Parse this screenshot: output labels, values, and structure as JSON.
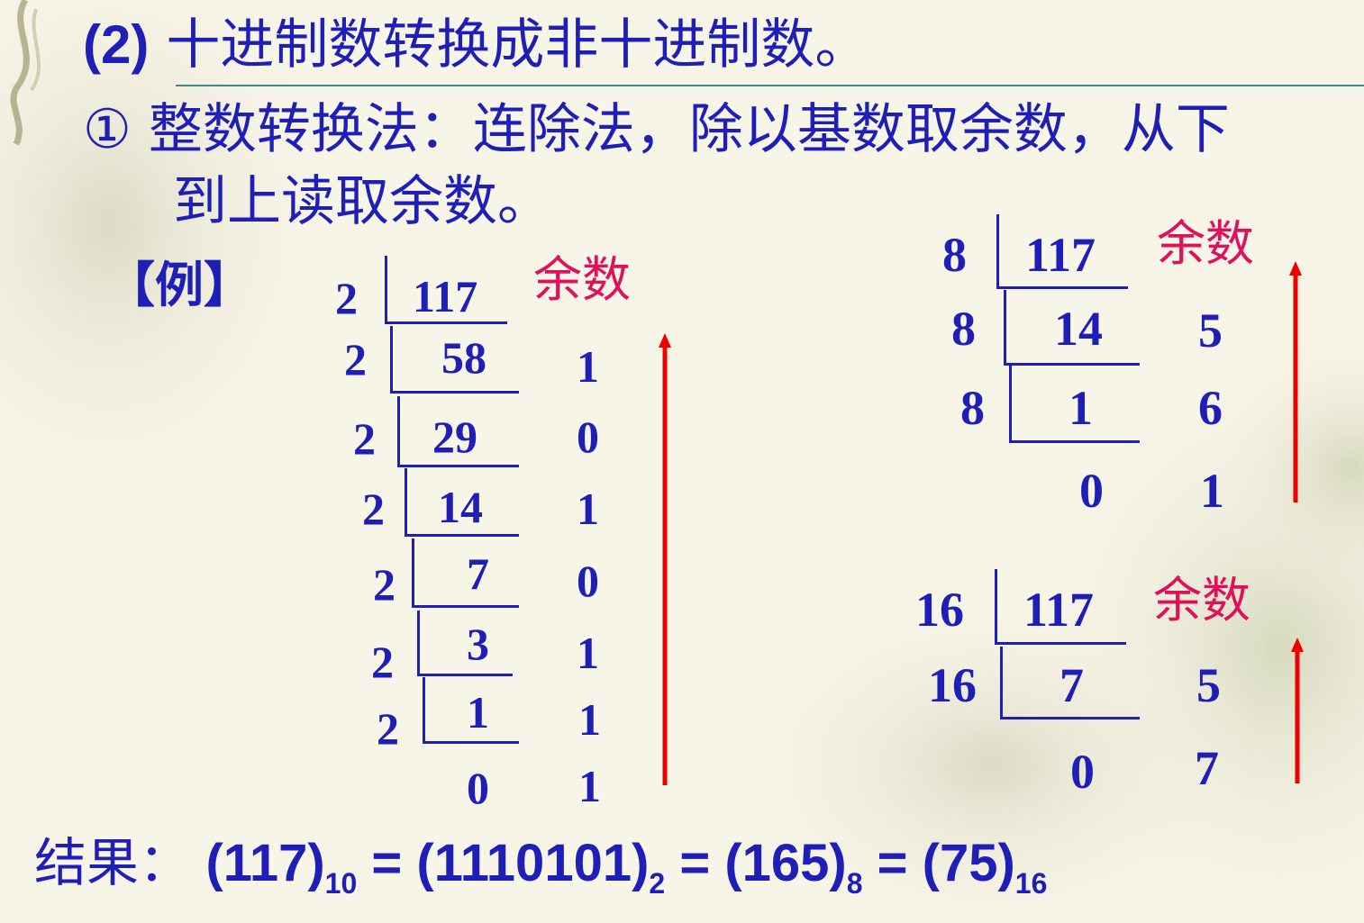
{
  "heading": {
    "number": "(2)",
    "text": "十进制数转换成非十进制数。"
  },
  "rule": {
    "line1": "① 整数转换法：连除法，除以基数取余数，从下",
    "line2": "到上读取余数。"
  },
  "example_label": "【例】",
  "remainder_label": "余数",
  "base2": {
    "divisor": "2",
    "rows": [
      {
        "divisor": "2",
        "dividend": "117",
        "remainder": ""
      },
      {
        "divisor": "2",
        "dividend": "58",
        "remainder": "1"
      },
      {
        "divisor": "2",
        "dividend": "29",
        "remainder": "0"
      },
      {
        "divisor": "2",
        "dividend": "14",
        "remainder": "1"
      },
      {
        "divisor": "2",
        "dividend": "7",
        "remainder": "0"
      },
      {
        "divisor": "2",
        "dividend": "3",
        "remainder": "1"
      },
      {
        "divisor": "2",
        "dividend": "1",
        "remainder": "1"
      },
      {
        "divisor": "",
        "dividend": "0",
        "remainder": "1"
      }
    ]
  },
  "base8": {
    "rows": [
      {
        "divisor": "8",
        "dividend": "117",
        "remainder": ""
      },
      {
        "divisor": "8",
        "dividend": "14",
        "remainder": "5"
      },
      {
        "divisor": "8",
        "dividend": "1",
        "remainder": "6"
      },
      {
        "divisor": "",
        "dividend": "0",
        "remainder": "1"
      }
    ]
  },
  "base16": {
    "rows": [
      {
        "divisor": "16",
        "dividend": "117",
        "remainder": ""
      },
      {
        "divisor": "16",
        "dividend": "7",
        "remainder": "5"
      },
      {
        "divisor": "",
        "dividend": "0",
        "remainder": "7"
      }
    ]
  },
  "result": {
    "label": "结果：",
    "p1": "(117)",
    "s1": "10",
    "eq1": " = ",
    "p2": "(1110101)",
    "s2": "2",
    "eq2": " = ",
    "p3": "(165)",
    "s3": "8",
    "eq3": " = ",
    "p4": "(75)",
    "s4": "16"
  },
  "colors": {
    "text_blue": "#1f1fb8",
    "remainder_label": "#e0105a",
    "arrow_red": "#ee0000",
    "rule_line": "#3f8a86"
  }
}
